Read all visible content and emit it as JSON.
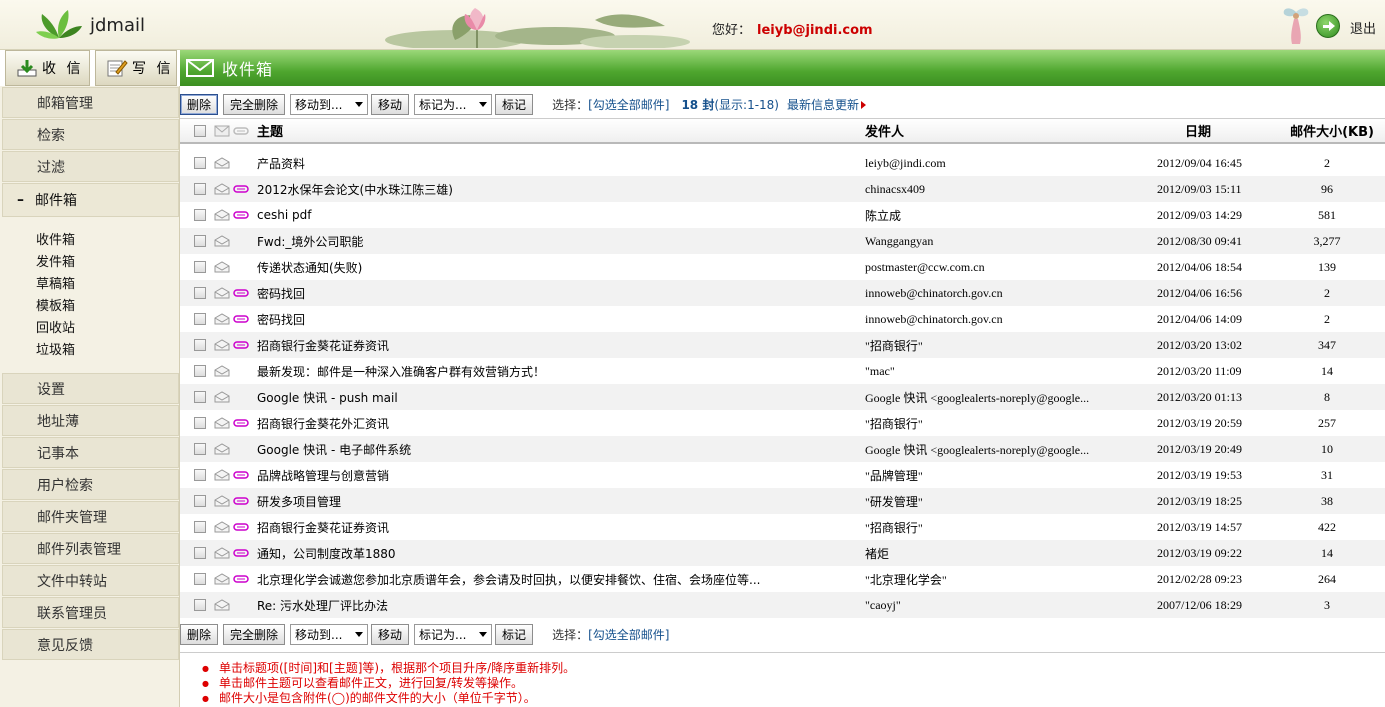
{
  "app": {
    "brand": "jdmail",
    "greeting": "您好：",
    "user": "leiyb@jindi.com",
    "logout": "退出"
  },
  "toolbar": {
    "receive": "收 信",
    "compose": "写 信"
  },
  "folder_title": "收件箱",
  "sidebar": {
    "top_items": [
      "邮箱管理",
      "检索",
      "过滤"
    ],
    "mailbox_group": {
      "minus": "–",
      "label": "邮件箱"
    },
    "mailbox_items": [
      "收件箱",
      "发件箱",
      "草稿箱",
      "模板箱",
      "回收站",
      "垃圾箱"
    ],
    "bottom_items": [
      "设置",
      "地址薄",
      "记事本",
      "用户检索",
      "邮件夹管理",
      "邮件列表管理",
      "文件中转站",
      "联系管理员",
      "意见反馈"
    ]
  },
  "actions": {
    "delete": "删除",
    "perm_delete": "完全删除",
    "move_to": "移动到...",
    "move": "移动",
    "mark_as": "标记为...",
    "mark": "标记",
    "select_label": "选择：",
    "select_all": "[勾选全部邮件]",
    "count": "18 封",
    "display_range": "(显示:1-18)",
    "latest": "最新信息更新"
  },
  "table": {
    "headers": {
      "subject": "主题",
      "from": "发件人",
      "date": "日期",
      "size": "邮件大小(KB)"
    },
    "rows": [
      {
        "subject": "产品资料",
        "from": "leiyb@jindi.com",
        "date": "2012/09/04 16:45",
        "size": "2",
        "att": false
      },
      {
        "subject": "2012水保年会论文(中水珠江陈三雄)",
        "from": "chinacsx409",
        "date": "2012/09/03 15:11",
        "size": "96",
        "att": true
      },
      {
        "subject": "ceshi pdf",
        "from": "陈立成",
        "date": "2012/09/03 14:29",
        "size": "581",
        "att": true
      },
      {
        "subject": "Fwd:_境外公司职能",
        "from": "Wanggangyan",
        "date": "2012/08/30 09:41",
        "size": "3,277",
        "att": false
      },
      {
        "subject": "传递状态通知(失败)",
        "from": "postmaster@ccw.com.cn",
        "date": "2012/04/06 18:54",
        "size": "139",
        "att": false
      },
      {
        "subject": "密码找回",
        "from": "innoweb@chinatorch.gov.cn",
        "date": "2012/04/06 16:56",
        "size": "2",
        "att": true
      },
      {
        "subject": "密码找回",
        "from": "innoweb@chinatorch.gov.cn",
        "date": "2012/04/06 14:09",
        "size": "2",
        "att": true
      },
      {
        "subject": "招商银行金葵花证券资讯",
        "from": "\"招商银行\"",
        "date": "2012/03/20 13:02",
        "size": "347",
        "att": true
      },
      {
        "subject": "最新发现：邮件是一种深入准确客户群有效营销方式！",
        "from": "\"mac\"",
        "date": "2012/03/20 11:09",
        "size": "14",
        "att": false
      },
      {
        "subject": "Google 快讯 - push mail",
        "from": "Google 快讯 <googlealerts-noreply@google...",
        "date": "2012/03/20 01:13",
        "size": "8",
        "att": false
      },
      {
        "subject": "招商银行金葵花外汇资讯",
        "from": "\"招商银行\"",
        "date": "2012/03/19 20:59",
        "size": "257",
        "att": true
      },
      {
        "subject": "Google 快讯 - 电子邮件系统",
        "from": "Google 快讯 <googlealerts-noreply@google...",
        "date": "2012/03/19 20:49",
        "size": "10",
        "att": false
      },
      {
        "subject": "品牌战略管理与创意营销",
        "from": "\"品牌管理\"",
        "date": "2012/03/19 19:53",
        "size": "31",
        "att": true
      },
      {
        "subject": "研发多项目管理",
        "from": "\"研发管理\"",
        "date": "2012/03/19 18:25",
        "size": "38",
        "att": true
      },
      {
        "subject": "招商银行金葵花证券资讯",
        "from": "\"招商银行\"",
        "date": "2012/03/19 14:57",
        "size": "422",
        "att": true
      },
      {
        "subject": "通知，公司制度改革1880",
        "from": "褚炬",
        "date": "2012/03/19 09:22",
        "size": "14",
        "att": true
      },
      {
        "subject": "北京理化学会诚邀您参加北京质谱年会，参会请及时回执，以便安排餐饮、住宿、会场座位等...",
        "from": "\"北京理化学会\"",
        "date": "2012/02/28 09:23",
        "size": "264",
        "att": true
      },
      {
        "subject": "Re: 污水处理厂评比办法",
        "from": "\"caoyj\"",
        "date": "2007/12/06 18:29",
        "size": "3",
        "att": false
      }
    ]
  },
  "notes": [
    "单击标题项([时间]和[主题]等)，根据那个项目升序/降序重新排列。",
    "单击邮件主题可以查看邮件正文，进行回复/转发等操作。",
    "邮件大小是包含附件(◯)的邮件文件的大小（单位千字节）。"
  ],
  "colors": {
    "accent_green": "#4ea62e",
    "link": "#15508c",
    "alert": "#cc0000",
    "attachment": "#cc00cc"
  }
}
